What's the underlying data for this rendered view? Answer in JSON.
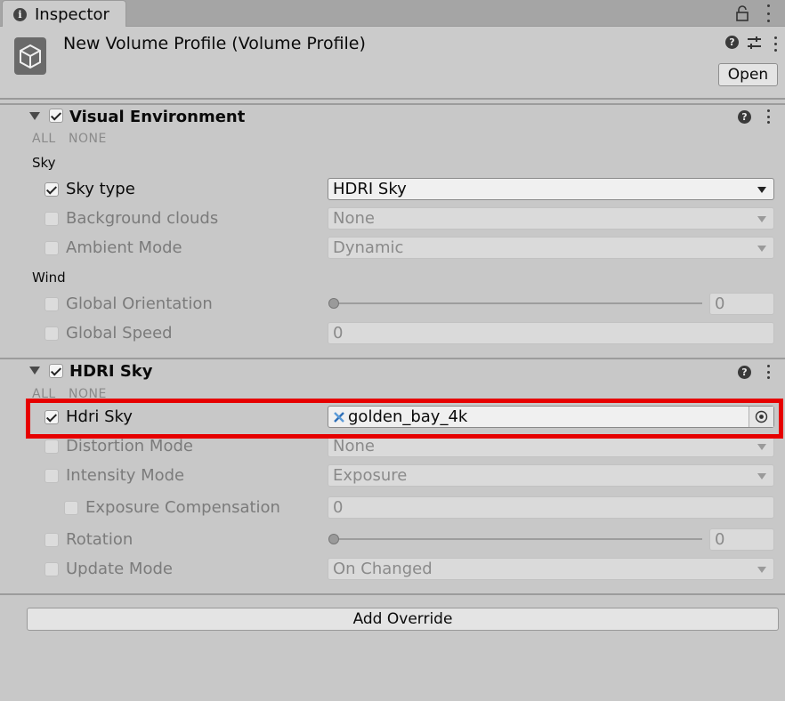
{
  "tab": {
    "title": "Inspector"
  },
  "header": {
    "title": "New Volume Profile (Volume Profile)",
    "open_label": "Open"
  },
  "sections": {
    "visual_environment": {
      "title": "Visual Environment",
      "enabled": true,
      "all_label": "ALL",
      "none_label": "NONE",
      "sky_group": "Sky",
      "wind_group": "Wind",
      "sky_type": {
        "label": "Sky type",
        "value": "HDRI Sky",
        "overridden": true
      },
      "background_clouds": {
        "label": "Background clouds",
        "value": "None",
        "overridden": false
      },
      "ambient_mode": {
        "label": "Ambient Mode",
        "value": "Dynamic",
        "overridden": false
      },
      "global_orientation": {
        "label": "Global Orientation",
        "value": "0",
        "overridden": false
      },
      "global_speed": {
        "label": "Global Speed",
        "value": "0",
        "overridden": false
      }
    },
    "hdri_sky": {
      "title": "HDRI Sky",
      "enabled": true,
      "all_label": "ALL",
      "none_label": "NONE",
      "hdri_sky": {
        "label": "Hdri Sky",
        "value": "golden_bay_4k",
        "overridden": true
      },
      "distortion_mode": {
        "label": "Distortion Mode",
        "value": "None",
        "overridden": false
      },
      "intensity_mode": {
        "label": "Intensity Mode",
        "value": "Exposure",
        "overridden": false
      },
      "exposure_compensation": {
        "label": "Exposure Compensation",
        "value": "0",
        "overridden": false
      },
      "rotation": {
        "label": "Rotation",
        "value": "0",
        "overridden": false
      },
      "update_mode": {
        "label": "Update Mode",
        "value": "On Changed",
        "overridden": false
      }
    }
  },
  "add_override_label": "Add Override",
  "colors": {
    "highlight": "#e60000",
    "panel": "#c8c8c8"
  }
}
